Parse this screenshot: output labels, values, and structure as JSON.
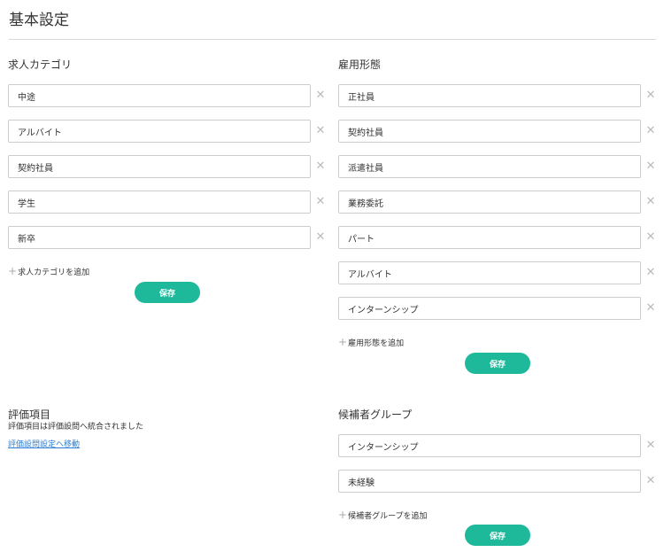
{
  "page": {
    "title": "基本設定"
  },
  "job_categories": {
    "title": "求人カテゴリ",
    "items": [
      "中途",
      "アルバイト",
      "契約社員",
      "学生",
      "新卒"
    ],
    "add_label": "求人カテゴリを追加",
    "save_label": "保存"
  },
  "employment_types": {
    "title": "雇用形態",
    "items": [
      "正社員",
      "契約社員",
      "派遣社員",
      "業務委託",
      "パート",
      "アルバイト",
      "インターンシップ"
    ],
    "add_label": "雇用形態を追加",
    "save_label": "保存"
  },
  "evaluation": {
    "title": "評価項目",
    "note": "評価項目は評価設問へ統合されました",
    "link_label": "評価設問設定へ移動"
  },
  "candidate_groups": {
    "title": "候補者グループ",
    "items": [
      "インターンシップ",
      "未経験"
    ],
    "add_label": "候補者グループを追加",
    "save_label": "保存"
  },
  "icons": {
    "remove": "close-icon",
    "add": "plus-icon"
  },
  "colors": {
    "accent": "#1db99a",
    "link": "#2a7fd4",
    "border": "#cccccc"
  }
}
